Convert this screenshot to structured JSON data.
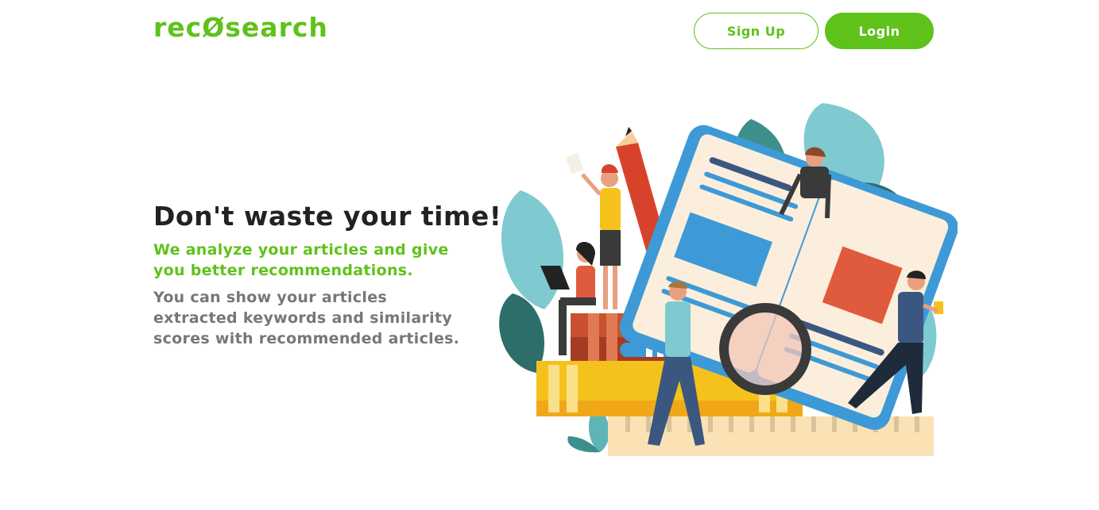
{
  "header": {
    "logo_text": "recØsearch",
    "signup_label": "Sign Up",
    "login_label": "Login"
  },
  "hero": {
    "headline": "Don't waste your time!",
    "subheadline": "We analyze your articles and give you better recommendations.",
    "description": "You can show your articles extracted keywords and similarity scores with recommended articles."
  },
  "colors": {
    "brand_green": "#5fc21a",
    "heading": "#222222",
    "body_text": "#777777"
  },
  "illustration": {
    "icon": "reading-books-illustration"
  }
}
